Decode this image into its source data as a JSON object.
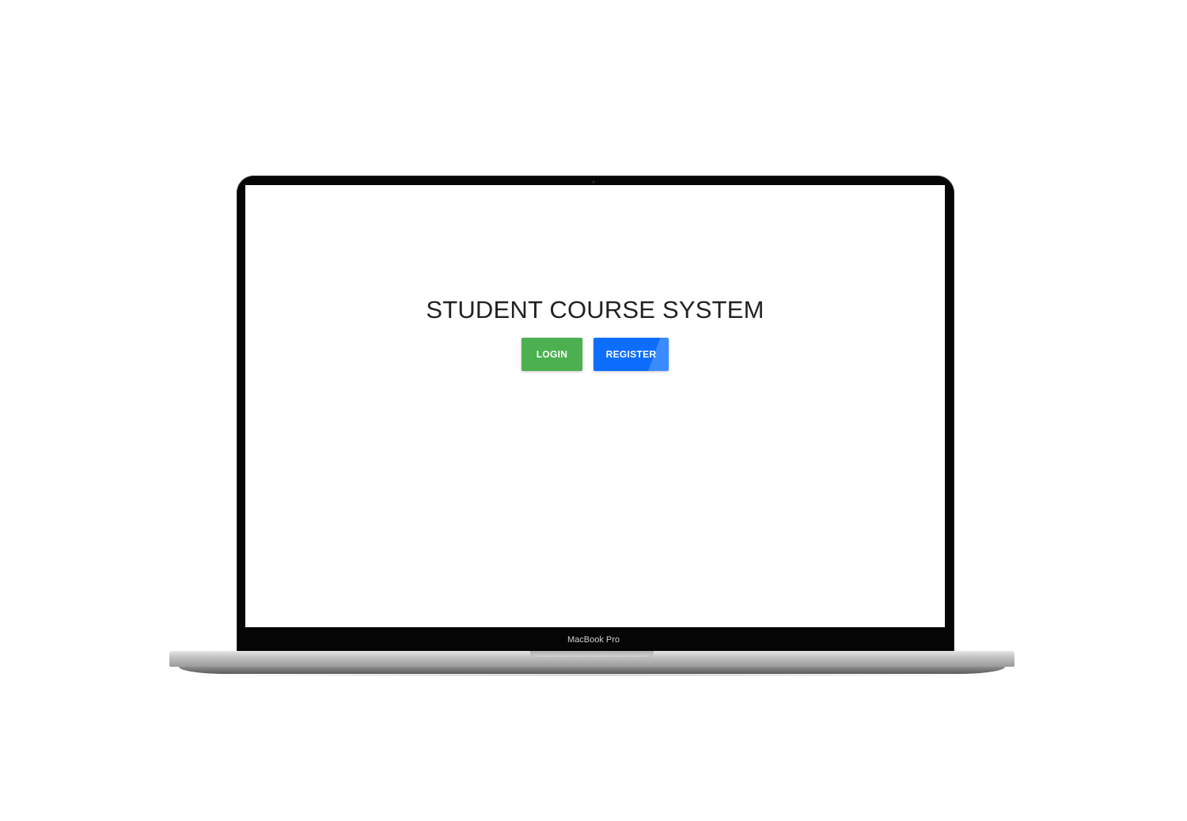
{
  "device": {
    "model_label": "MacBook Pro"
  },
  "app": {
    "title": "STUDENT COURSE SYSTEM",
    "buttons": {
      "login_label": "LOGIN",
      "register_label": "REGISTER"
    }
  },
  "colors": {
    "login_button": "#4caf50",
    "register_button": "#0d6efd",
    "title_text": "#222222"
  }
}
